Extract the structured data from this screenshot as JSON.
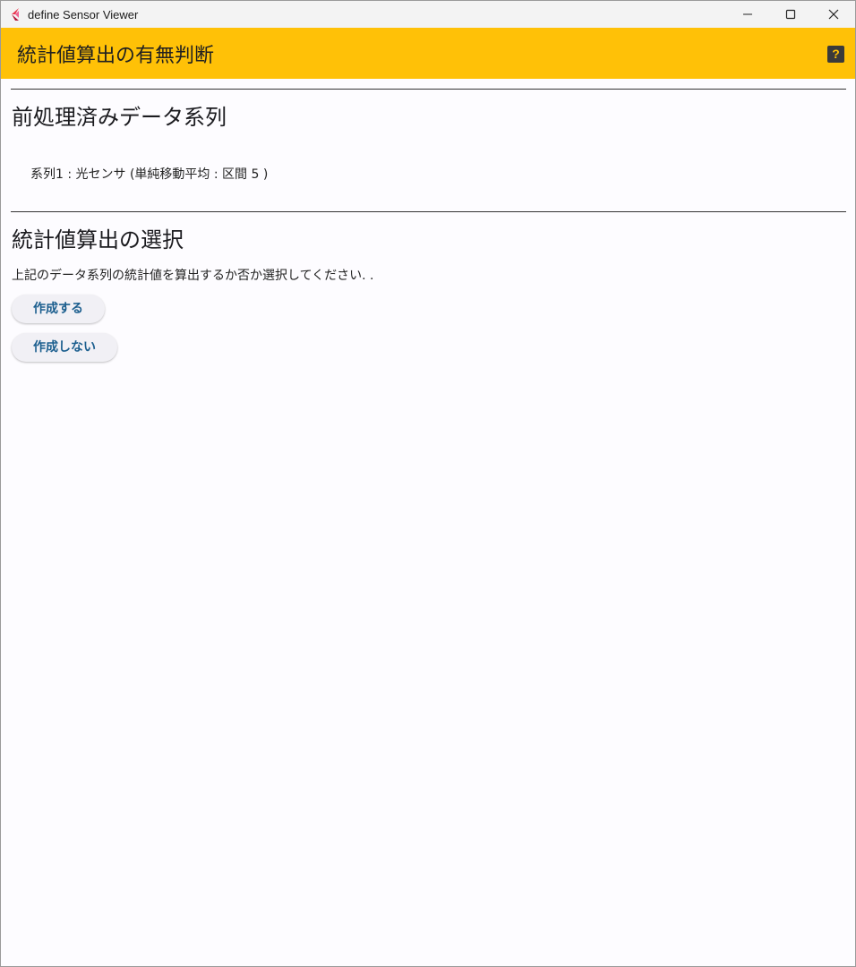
{
  "window": {
    "title": "define Sensor Viewer",
    "minimize_icon": "minimize-icon",
    "maximize_icon": "maximize-icon",
    "close_icon": "close-icon"
  },
  "appbar": {
    "title": "統計値算出の有無判断",
    "help_label": "?",
    "accent_color": "#ffc107"
  },
  "sections": {
    "preprocessed": {
      "title": "前処理済みデータ系列",
      "series_text": "系列1 : 光センサ (単純移動平均 : 区間 5 )"
    },
    "selection": {
      "title": "統計値算出の選択",
      "description": "上記のデータ系列の統計値を算出するか否か選択してください. .",
      "create_label": "作成する",
      "not_create_label": "作成しない"
    }
  },
  "colors": {
    "button_text": "#1b5e8e",
    "background": "#fdfcff"
  }
}
